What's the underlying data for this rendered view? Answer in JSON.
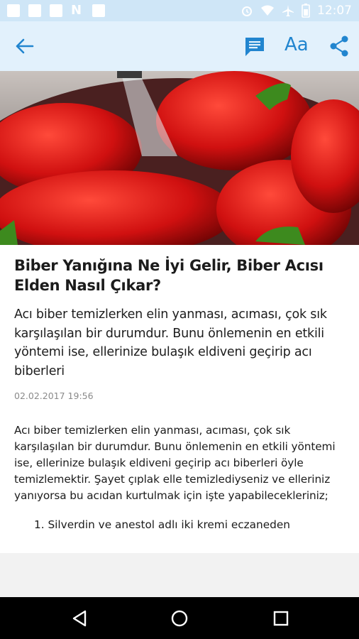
{
  "status_bar": {
    "time": "12:07",
    "icons": [
      "photo-icon",
      "image-icon",
      "blank-icon",
      "n-icon",
      "check-icon",
      "alarm-icon",
      "wifi-icon",
      "airplane-icon",
      "battery-icon"
    ]
  },
  "app_bar": {
    "back_icon": "arrow-left-icon",
    "comment_icon": "comment-icon",
    "font_label": "Aa",
    "share_icon": "share-icon",
    "accent_color": "#2185cf"
  },
  "article": {
    "title": "Biber Yanığına Ne İyi Gelir, Biber Acısı Elden Nasıl Çıkar?",
    "summary": "Acı biber temizlerken elin yanması, acıması, çok sık karşılaşılan bir durumdur. Bunu önlemenin en etkili yöntemi ise, ellerinize bulaşık eldiveni geçirip acı biberleri",
    "date": "02.02.2017 19:56",
    "body": "Acı biber temizlerken elin yanması, acıması, çok sık karşılaşılan bir durumdur. Bunu önlemenin en etkili yöntemi ise, ellerinize bulaşık eldiveni geçirip acı biberleri öyle temizlemektir. Şayet çıplak elle temizlediyseniz ve elleriniz yanıyorsa bu acıdan kurtulmak için işte yapabilecekleriniz;",
    "list": [
      "1. Silverdin ve anestol adlı iki kremi eczaneden"
    ]
  },
  "nav_bar": {
    "icons": [
      "back-triangle-icon",
      "home-circle-icon",
      "recents-square-icon"
    ]
  }
}
